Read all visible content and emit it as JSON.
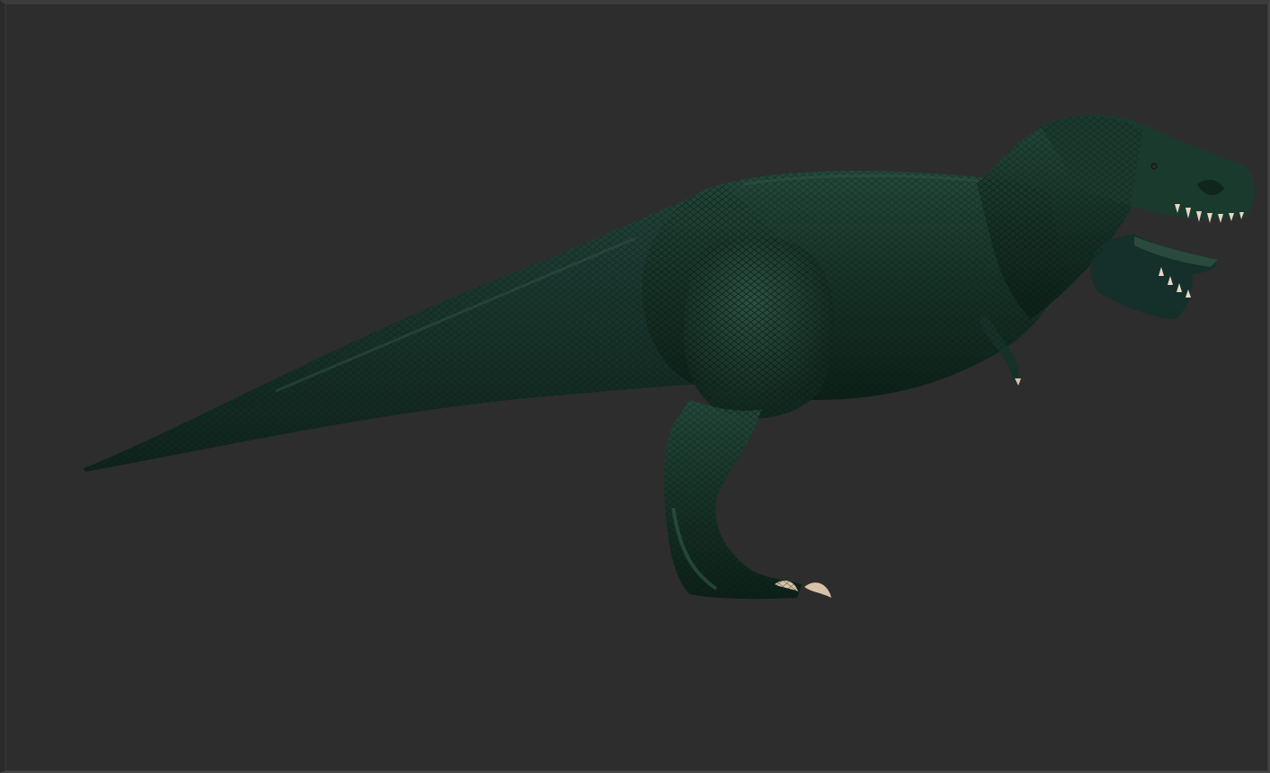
{
  "viewport": {
    "background_color": "#2d2d2d",
    "border_color": "#444444"
  },
  "model": {
    "subject": "tyrannosaurus-sculpt",
    "material_color": "#143024",
    "highlight_color": "#2f5446",
    "claw_color": "#d8c2a8",
    "teeth_color": "#e6d8c4"
  }
}
